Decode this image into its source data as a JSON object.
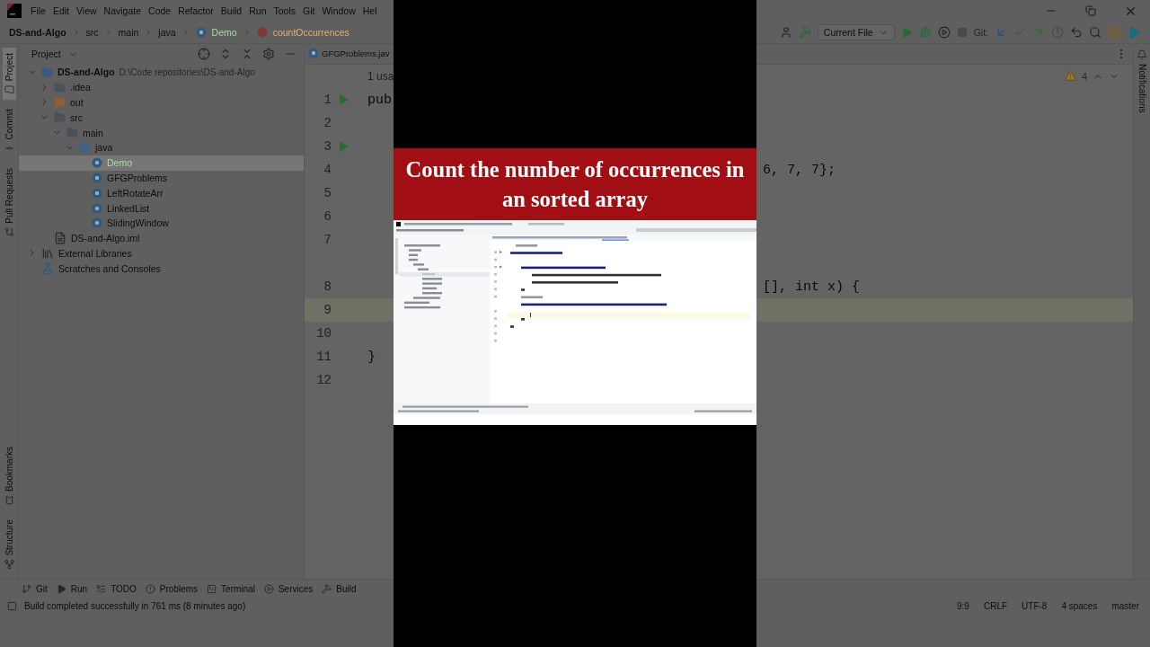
{
  "background_ide": {
    "menu": [
      "File",
      "Edit",
      "View",
      "Navigate",
      "Code",
      "Refactor",
      "Build",
      "Run",
      "Tools",
      "Git",
      "Window",
      "Hel"
    ],
    "breadcrumb": [
      {
        "label": "DS-and-Algo",
        "kind": "project"
      },
      {
        "label": "src",
        "kind": "folder"
      },
      {
        "label": "main",
        "kind": "folder"
      },
      {
        "label": "java",
        "kind": "folder"
      },
      {
        "label": "Demo",
        "kind": "class",
        "color": "#a6dca6"
      },
      {
        "label": "countOccurrences",
        "kind": "method",
        "color": "#e0b070"
      }
    ],
    "toolbar": {
      "run_config": "Current File",
      "git_label": "Git:"
    },
    "left_stripe": [
      {
        "label": "Project",
        "kind": "project",
        "selected": true
      },
      {
        "label": "Commit",
        "kind": "commit",
        "selected": false
      },
      {
        "label": "Pull Requests",
        "kind": "pulls",
        "selected": false
      }
    ],
    "left_stripe_bottom": [
      {
        "label": "Bookmarks",
        "kind": "bookmarks"
      },
      {
        "label": "Structure",
        "kind": "structure"
      }
    ],
    "project_panel": {
      "title": "Project",
      "tree": [
        {
          "label": "DS-and-Algo",
          "kind": "module",
          "note": "D:\\Code repositories\\DS-and-Algo",
          "expanded": true,
          "selected": false,
          "children": [
            {
              "label": ".idea",
              "kind": "folder",
              "expanded": false,
              "selected": false
            },
            {
              "label": "out",
              "kind": "excluded",
              "expanded": false,
              "selected": false
            },
            {
              "label": "src",
              "kind": "folder",
              "expanded": true,
              "selected": false,
              "children": [
                {
                  "label": "main",
                  "kind": "folder",
                  "expanded": true,
                  "selected": false,
                  "children": [
                    {
                      "label": "java",
                      "kind": "source",
                      "expanded": true,
                      "selected": false,
                      "children": [
                        {
                          "label": "Demo",
                          "kind": "class",
                          "selected": true,
                          "color": "#a6dca6"
                        },
                        {
                          "label": "GFGProblems",
                          "kind": "class",
                          "selected": false
                        },
                        {
                          "label": "LeftRotateArr",
                          "kind": "class",
                          "selected": false
                        },
                        {
                          "label": "LinkedList",
                          "kind": "class",
                          "selected": false
                        },
                        {
                          "label": "SlidingWindow",
                          "kind": "class",
                          "selected": false
                        }
                      ]
                    }
                  ]
                }
              ]
            },
            {
              "label": "DS-and-Algo.iml",
              "kind": "file",
              "selected": false
            }
          ]
        },
        {
          "label": "External Libraries",
          "kind": "libraries",
          "expanded": false,
          "selected": false
        },
        {
          "label": "Scratches and Consoles",
          "kind": "scratches",
          "selected": false
        }
      ]
    },
    "tabs": [
      {
        "label": "GFGProblems.jav",
        "selected": false
      }
    ],
    "inspections": "4",
    "lines": [
      {
        "kind": "usage",
        "text": "1 usa"
      },
      {
        "kind": "code",
        "number": "1",
        "run": true,
        "text": "pub",
        "selected": false
      },
      {
        "kind": "code",
        "number": "2",
        "run": false,
        "selected": false
      },
      {
        "kind": "code",
        "number": "3",
        "run": true,
        "selected": false
      },
      {
        "kind": "code",
        "number": "4",
        "run": false,
        "text_right": "6, 7, 7};",
        "selected": false
      },
      {
        "kind": "code",
        "number": "5",
        "run": false,
        "selected": false
      },
      {
        "kind": "code",
        "number": "6",
        "run": false,
        "selected": false
      },
      {
        "kind": "code",
        "number": "7",
        "run": false,
        "selected": false
      },
      {
        "kind": "usage"
      },
      {
        "kind": "code",
        "number": "8",
        "run": false,
        "text_right": "[], int x) {",
        "selected": false
      },
      {
        "kind": "code",
        "number": "9",
        "run": false,
        "selected": true
      },
      {
        "kind": "code",
        "number": "10",
        "run": false,
        "selected": false
      },
      {
        "kind": "code",
        "number": "11",
        "run": false,
        "text": "}",
        "selected": false
      },
      {
        "kind": "code",
        "number": "12",
        "run": false,
        "selected": false
      }
    ],
    "notifications": "Notifications",
    "bottom_tools": [
      {
        "label": "Git",
        "kind": "git"
      },
      {
        "label": "Run",
        "kind": "run"
      },
      {
        "label": "TODO",
        "kind": "todo"
      },
      {
        "label": "Problems",
        "kind": "problems"
      },
      {
        "label": "Terminal",
        "kind": "terminal"
      },
      {
        "label": "Services",
        "kind": "services"
      },
      {
        "label": "Build",
        "kind": "build"
      }
    ],
    "status": {
      "message": "Build completed successfully in 761 ms (8 minutes ago)",
      "items": [
        "9:9",
        "CRLF",
        "UTF-8",
        "4 spaces",
        "master"
      ]
    }
  },
  "video": {
    "title": "Count the number of occurrences in an sorted array"
  }
}
